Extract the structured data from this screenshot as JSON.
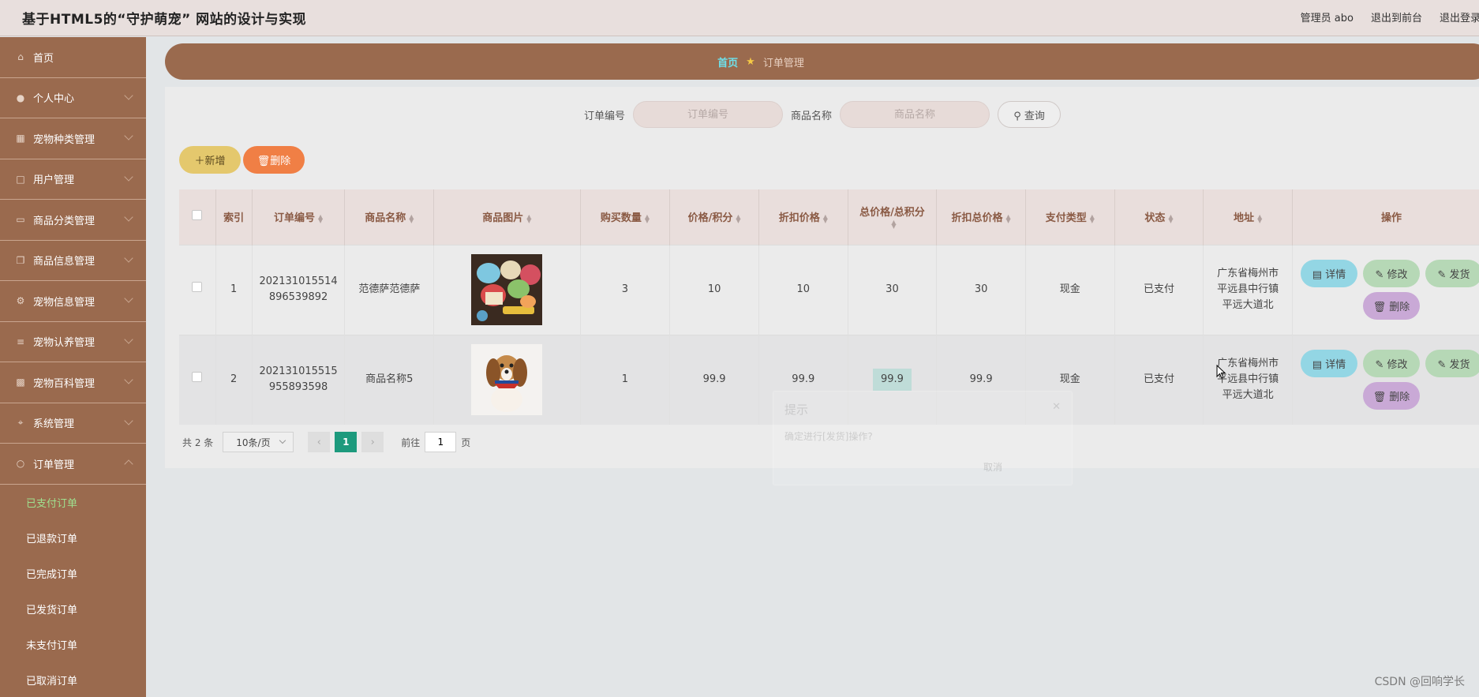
{
  "header": {
    "title": "基于HTML5的“守护萌宠” 网站的设计与实现",
    "admin_text": "管理员 abo",
    "front_link": "退出到前台",
    "logout_link": "退出登录"
  },
  "sidebar": {
    "items": [
      {
        "label": "首页",
        "icon": "home-icon"
      },
      {
        "label": "个人中心",
        "icon": "user-icon"
      },
      {
        "label": "宠物种类管理",
        "icon": "grid-icon"
      },
      {
        "label": "用户管理",
        "icon": "chat-icon"
      },
      {
        "label": "商品分类管理",
        "icon": "monitor-icon"
      },
      {
        "label": "商品信息管理",
        "icon": "copy-icon"
      },
      {
        "label": "宠物信息管理",
        "icon": "gear-icon"
      },
      {
        "label": "宠物认养管理",
        "icon": "sliders-icon"
      },
      {
        "label": "宠物百科管理",
        "icon": "bar-chart-icon"
      },
      {
        "label": "系统管理",
        "icon": "crop-icon"
      },
      {
        "label": "订单管理",
        "icon": "mic-icon"
      }
    ],
    "sub_items": [
      "已支付订单",
      "已退款订单",
      "已完成订单",
      "已发货订单",
      "未支付订单",
      "已取消订单"
    ]
  },
  "breadcrumb": {
    "home": "首页",
    "current": "订单管理"
  },
  "search": {
    "order_no_label": "订单编号",
    "order_no_placeholder": "订单编号",
    "product_label": "商品名称",
    "product_placeholder": "商品名称",
    "query_button": "查询"
  },
  "toolbar": {
    "add_label": "新增",
    "delete_label": "删除"
  },
  "table": {
    "headers": [
      "索引",
      "订单编号",
      "商品名称",
      "商品图片",
      "购买数量",
      "价格/积分",
      "折扣价格",
      "总价格/总积分",
      "折扣总价格",
      "支付类型",
      "状态",
      "地址",
      "操作"
    ],
    "rows": [
      {
        "index": "1",
        "order_no": "202131015514896539892",
        "product": "范德萨范德萨",
        "qty": "3",
        "price": "10",
        "discount_price": "10",
        "total": "30",
        "discount_total": "30",
        "pay_type": "现金",
        "status": "已支付",
        "address": "广东省梅州市平远县中行镇平远大道北"
      },
      {
        "index": "2",
        "order_no": "202131015515955893598",
        "product": "商品名称5",
        "qty": "1",
        "price": "99.9",
        "discount_price": "99.9",
        "total": "99.9",
        "discount_total": "99.9",
        "pay_type": "现金",
        "status": "已支付",
        "address": "广东省梅州市平远县中行镇平远大道北"
      }
    ],
    "ops": {
      "detail": "详情",
      "edit": "修改",
      "ship": "发货",
      "remove": "删除"
    }
  },
  "pager": {
    "total": "共 2 条",
    "page_size": "10条/页",
    "current_page": "1",
    "goto_label": "前往",
    "goto_value": "1",
    "page_unit": "页"
  },
  "dialog": {
    "title": "提示",
    "message": "确定进行[发货]操作?",
    "cancel": "取消"
  },
  "watermark": "CSDN @回响学长",
  "colors": {
    "sidebar": "#9a6a4e",
    "header": "#e8dfdd",
    "active_menu": "#9fe08f",
    "pager_active": "#1d9a7d"
  }
}
